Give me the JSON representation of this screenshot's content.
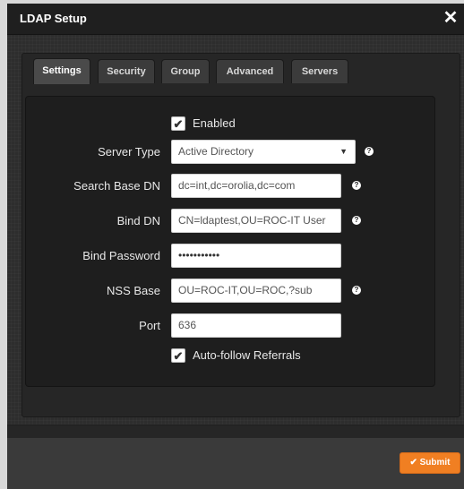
{
  "window": {
    "title": "LDAP Setup",
    "close_glyph": "✕"
  },
  "tabs": [
    {
      "label": "Settings",
      "active": true
    },
    {
      "label": "Security",
      "active": false
    },
    {
      "label": "Group",
      "active": false
    },
    {
      "label": "Advanced",
      "active": false
    },
    {
      "label": "Servers",
      "active": false
    }
  ],
  "form": {
    "enabled": {
      "label": "Enabled",
      "checked": true
    },
    "server_type": {
      "label": "Server Type",
      "value": "Active Directory"
    },
    "search_base_dn": {
      "label": "Search Base DN",
      "value": "dc=int,dc=orolia,dc=com"
    },
    "bind_dn": {
      "label": "Bind DN",
      "value": "CN=ldaptest,OU=ROC-IT User"
    },
    "bind_password": {
      "label": "Bind Password",
      "value": "•••••••••••"
    },
    "nss_base": {
      "label": "NSS Base",
      "value": "OU=ROC-IT,OU=ROC,?sub"
    },
    "port": {
      "label": "Port",
      "value": "636"
    },
    "auto_follow_referrals": {
      "label": "Auto-follow Referrals",
      "checked": true
    }
  },
  "icons": {
    "check": "✔",
    "help": "?",
    "dropdown": "▼"
  },
  "footer": {
    "submit_label": "✔ Submit"
  },
  "colors": {
    "accent": "#f07f22",
    "background": "#2b2b2b"
  }
}
